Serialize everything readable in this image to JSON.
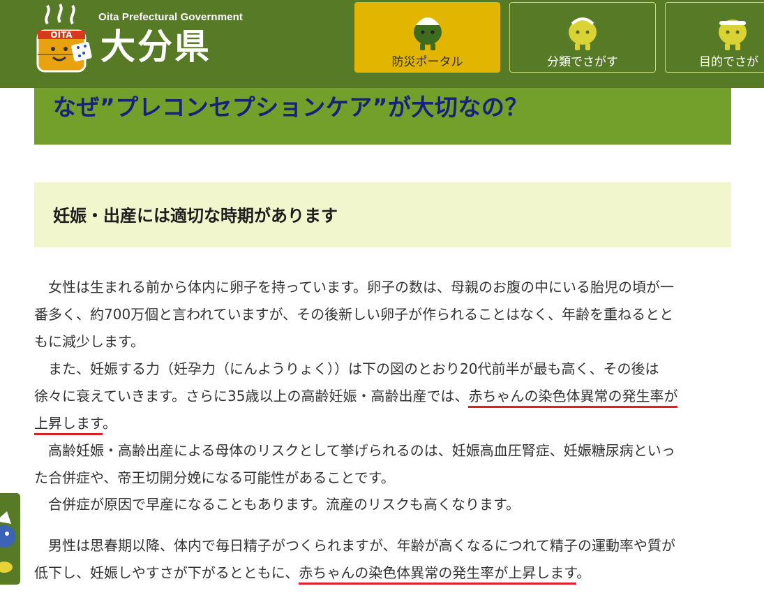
{
  "header": {
    "logo_text": "OITA",
    "org_name_en": "Oita Prefectural Government",
    "org_name_ja": "大分県",
    "nav": [
      {
        "label": "防災ポータル",
        "icon": "disaster-mascot-icon",
        "active": true
      },
      {
        "label": "分類でさがす",
        "icon": "category-mascot-icon",
        "active": false
      },
      {
        "label": "目的でさが",
        "icon": "purpose-mascot-icon",
        "active": false
      }
    ]
  },
  "main": {
    "page_title": "なぜ”プレコンセプションケア”が大切なの？",
    "section_heading": "妊娠・出産には適切な時期があります",
    "lines": [
      "　女性は生まれる前から体内に卵子を持っています。卵子の数は、母親のお腹の中にいる胎児の頃が一",
      "番多く、約700万個と言われていますが、その後新しい卵子が作られることはなく、年齢を重ねるとと",
      "もに減少します。",
      "　また、妊娠する力（妊孕力（にんようりょく））は下の図のとおり20代前半が最も高く、その後は",
      "徐々に衰えていきます。さらに35歳以上の高齢妊娠・高齢出産では、",
      "赤ちゃんの染色体異常の発生率が",
      "上昇します",
      "。",
      "　高齢妊娠・高齢出産による母体のリスクとして挙げられるのは、妊娠高血圧腎症、妊娠糖尿病といっ",
      "た合併症や、帝王切開分娩になる可能性があることです。",
      "　合併症が原因で早産になることもあります。流産のリスクも高くなります。",
      "　男性は思春期以降、体内で毎日精子がつくられますが、年齢が高くなるにつれて精子の運動率や質が",
      "低下し、妊娠しやすさが下がるとともに、",
      "赤ちゃんの染色体異常の発生率が上昇します",
      "。"
    ]
  },
  "colors": {
    "header_bg": "#567a26",
    "nav_active_bg": "#e2b500",
    "title_band_bg": "#72a02a",
    "title_text": "#17227a",
    "section_bg": "#f1f6cc",
    "underline": "#e01e2a"
  }
}
